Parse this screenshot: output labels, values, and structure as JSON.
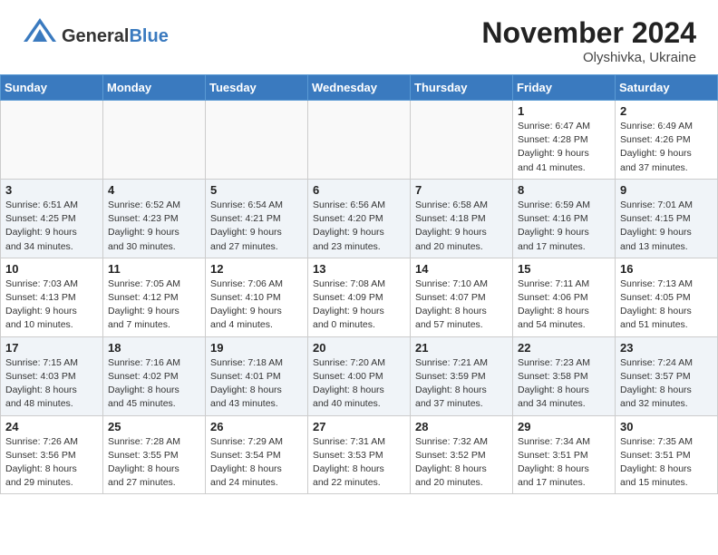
{
  "header": {
    "month_title": "November 2024",
    "location": "Olyshivka, Ukraine",
    "logo_general": "General",
    "logo_blue": "Blue"
  },
  "weekdays": [
    "Sunday",
    "Monday",
    "Tuesday",
    "Wednesday",
    "Thursday",
    "Friday",
    "Saturday"
  ],
  "weeks": [
    [
      {
        "day": "",
        "info": ""
      },
      {
        "day": "",
        "info": ""
      },
      {
        "day": "",
        "info": ""
      },
      {
        "day": "",
        "info": ""
      },
      {
        "day": "",
        "info": ""
      },
      {
        "day": "1",
        "info": "Sunrise: 6:47 AM\nSunset: 4:28 PM\nDaylight: 9 hours\nand 41 minutes."
      },
      {
        "day": "2",
        "info": "Sunrise: 6:49 AM\nSunset: 4:26 PM\nDaylight: 9 hours\nand 37 minutes."
      }
    ],
    [
      {
        "day": "3",
        "info": "Sunrise: 6:51 AM\nSunset: 4:25 PM\nDaylight: 9 hours\nand 34 minutes."
      },
      {
        "day": "4",
        "info": "Sunrise: 6:52 AM\nSunset: 4:23 PM\nDaylight: 9 hours\nand 30 minutes."
      },
      {
        "day": "5",
        "info": "Sunrise: 6:54 AM\nSunset: 4:21 PM\nDaylight: 9 hours\nand 27 minutes."
      },
      {
        "day": "6",
        "info": "Sunrise: 6:56 AM\nSunset: 4:20 PM\nDaylight: 9 hours\nand 23 minutes."
      },
      {
        "day": "7",
        "info": "Sunrise: 6:58 AM\nSunset: 4:18 PM\nDaylight: 9 hours\nand 20 minutes."
      },
      {
        "day": "8",
        "info": "Sunrise: 6:59 AM\nSunset: 4:16 PM\nDaylight: 9 hours\nand 17 minutes."
      },
      {
        "day": "9",
        "info": "Sunrise: 7:01 AM\nSunset: 4:15 PM\nDaylight: 9 hours\nand 13 minutes."
      }
    ],
    [
      {
        "day": "10",
        "info": "Sunrise: 7:03 AM\nSunset: 4:13 PM\nDaylight: 9 hours\nand 10 minutes."
      },
      {
        "day": "11",
        "info": "Sunrise: 7:05 AM\nSunset: 4:12 PM\nDaylight: 9 hours\nand 7 minutes."
      },
      {
        "day": "12",
        "info": "Sunrise: 7:06 AM\nSunset: 4:10 PM\nDaylight: 9 hours\nand 4 minutes."
      },
      {
        "day": "13",
        "info": "Sunrise: 7:08 AM\nSunset: 4:09 PM\nDaylight: 9 hours\nand 0 minutes."
      },
      {
        "day": "14",
        "info": "Sunrise: 7:10 AM\nSunset: 4:07 PM\nDaylight: 8 hours\nand 57 minutes."
      },
      {
        "day": "15",
        "info": "Sunrise: 7:11 AM\nSunset: 4:06 PM\nDaylight: 8 hours\nand 54 minutes."
      },
      {
        "day": "16",
        "info": "Sunrise: 7:13 AM\nSunset: 4:05 PM\nDaylight: 8 hours\nand 51 minutes."
      }
    ],
    [
      {
        "day": "17",
        "info": "Sunrise: 7:15 AM\nSunset: 4:03 PM\nDaylight: 8 hours\nand 48 minutes."
      },
      {
        "day": "18",
        "info": "Sunrise: 7:16 AM\nSunset: 4:02 PM\nDaylight: 8 hours\nand 45 minutes."
      },
      {
        "day": "19",
        "info": "Sunrise: 7:18 AM\nSunset: 4:01 PM\nDaylight: 8 hours\nand 43 minutes."
      },
      {
        "day": "20",
        "info": "Sunrise: 7:20 AM\nSunset: 4:00 PM\nDaylight: 8 hours\nand 40 minutes."
      },
      {
        "day": "21",
        "info": "Sunrise: 7:21 AM\nSunset: 3:59 PM\nDaylight: 8 hours\nand 37 minutes."
      },
      {
        "day": "22",
        "info": "Sunrise: 7:23 AM\nSunset: 3:58 PM\nDaylight: 8 hours\nand 34 minutes."
      },
      {
        "day": "23",
        "info": "Sunrise: 7:24 AM\nSunset: 3:57 PM\nDaylight: 8 hours\nand 32 minutes."
      }
    ],
    [
      {
        "day": "24",
        "info": "Sunrise: 7:26 AM\nSunset: 3:56 PM\nDaylight: 8 hours\nand 29 minutes."
      },
      {
        "day": "25",
        "info": "Sunrise: 7:28 AM\nSunset: 3:55 PM\nDaylight: 8 hours\nand 27 minutes."
      },
      {
        "day": "26",
        "info": "Sunrise: 7:29 AM\nSunset: 3:54 PM\nDaylight: 8 hours\nand 24 minutes."
      },
      {
        "day": "27",
        "info": "Sunrise: 7:31 AM\nSunset: 3:53 PM\nDaylight: 8 hours\nand 22 minutes."
      },
      {
        "day": "28",
        "info": "Sunrise: 7:32 AM\nSunset: 3:52 PM\nDaylight: 8 hours\nand 20 minutes."
      },
      {
        "day": "29",
        "info": "Sunrise: 7:34 AM\nSunset: 3:51 PM\nDaylight: 8 hours\nand 17 minutes."
      },
      {
        "day": "30",
        "info": "Sunrise: 7:35 AM\nSunset: 3:51 PM\nDaylight: 8 hours\nand 15 minutes."
      }
    ]
  ]
}
